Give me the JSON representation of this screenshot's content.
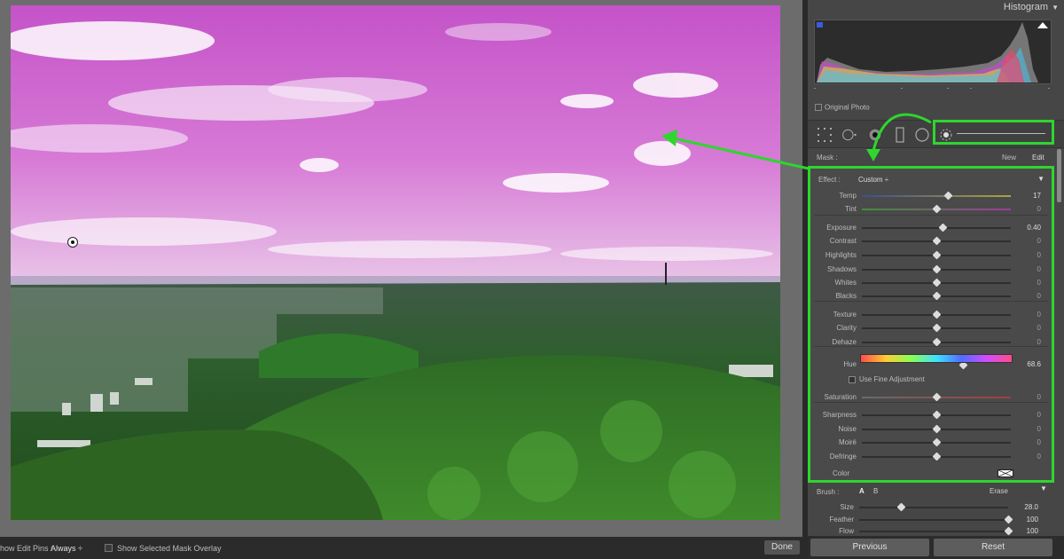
{
  "toolbar": {
    "edit_pins_label": "how Edit Pins :",
    "edit_pins_value": "Always ÷",
    "mask_overlay_label": "Show Selected Mask Overlay",
    "done_label": "Done"
  },
  "histogram": {
    "title": "Histogram",
    "original_photo_label": "Original Photo"
  },
  "mask": {
    "label": "Mask :",
    "new_label": "New",
    "edit_label": "Edit"
  },
  "effect": {
    "label": "Effect :",
    "preset": "Custom ÷",
    "sliders": [
      {
        "label": "Temp",
        "value": "17",
        "pos": 0.58,
        "active": true
      },
      {
        "label": "Tint",
        "value": "0",
        "pos": 0.5,
        "active": false
      },
      {
        "label": "Exposure",
        "value": "0.40",
        "pos": 0.54,
        "active": true
      },
      {
        "label": "Contrast",
        "value": "0",
        "pos": 0.5,
        "active": false
      },
      {
        "label": "Highlights",
        "value": "0",
        "pos": 0.5,
        "active": false
      },
      {
        "label": "Shadows",
        "value": "0",
        "pos": 0.5,
        "active": false
      },
      {
        "label": "Whites",
        "value": "0",
        "pos": 0.5,
        "active": false
      },
      {
        "label": "Blacks",
        "value": "0",
        "pos": 0.5,
        "active": false
      },
      {
        "label": "Texture",
        "value": "0",
        "pos": 0.5,
        "active": false
      },
      {
        "label": "Clarity",
        "value": "0",
        "pos": 0.5,
        "active": false
      },
      {
        "label": "Dehaze",
        "value": "0",
        "pos": 0.5,
        "active": false
      },
      {
        "label": "Hue",
        "value": "68.6",
        "pos": 0.68,
        "active": true
      },
      {
        "label": "Saturation",
        "value": "0",
        "pos": 0.5,
        "active": false
      },
      {
        "label": "Sharpness",
        "value": "0",
        "pos": 0.5,
        "active": false
      },
      {
        "label": "Noise",
        "value": "0",
        "pos": 0.5,
        "active": false
      },
      {
        "label": "Moiré",
        "value": "0",
        "pos": 0.5,
        "active": false
      },
      {
        "label": "Defringe",
        "value": "0",
        "pos": 0.5,
        "active": false
      }
    ],
    "fine_adjustment_label": "Use Fine Adjustment",
    "color_label": "Color"
  },
  "brush": {
    "label": "Brush :",
    "a_label": "A",
    "b_label": "B",
    "erase_label": "Erase",
    "sliders": [
      {
        "label": "Size",
        "value": "28.0",
        "pos": 0.28
      },
      {
        "label": "Feather",
        "value": "100",
        "pos": 1.0
      },
      {
        "label": "Flow",
        "value": "100",
        "pos": 1.0
      }
    ]
  },
  "buttons": {
    "previous_label": "Previous",
    "reset_label": "Reset"
  },
  "colors": {
    "highlight": "#2ed62e",
    "sky_tint": "#d46ad6"
  }
}
